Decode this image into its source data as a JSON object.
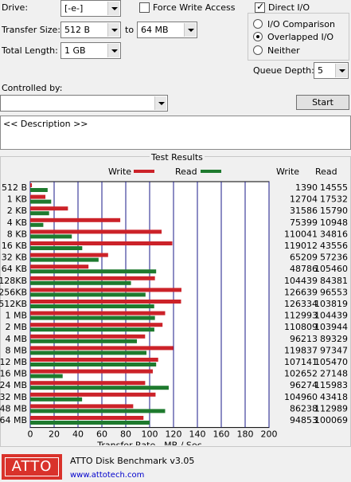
{
  "settings": {
    "drive_label": "Drive:",
    "drive_value": "[-e-]",
    "transfer_size_label": "Transfer Size:",
    "transfer_from": "512 B",
    "to_label": "to",
    "transfer_to": "64 MB",
    "total_length_label": "Total Length:",
    "total_length_value": "1 GB",
    "force_write_label": "Force Write Access",
    "direct_io_label": "Direct I/O",
    "io_comparison_label": "I/O Comparison",
    "overlapped_io_label": "Overlapped I/O",
    "neither_label": "Neither",
    "queue_depth_label": "Queue Depth:",
    "queue_depth_value": "5",
    "controlled_by_label": "Controlled by:",
    "controlled_by_value": "",
    "start_label": "Start",
    "description_text": "<< Description >>"
  },
  "results": {
    "title": "Test Results",
    "write_legend": "Write",
    "read_legend": "Read",
    "write_header": "Write",
    "read_header": "Read",
    "write_color": "#cc2229",
    "read_color": "#1e7a2e"
  },
  "chart_data": {
    "type": "bar",
    "orientation": "horizontal",
    "categories": [
      "512 B",
      "1 KB",
      "2 KB",
      "4 KB",
      "8 KB",
      "16 KB",
      "32 KB",
      "64 KB",
      "128KB",
      "256KB",
      "512KB",
      "1 MB",
      "2 MB",
      "4 MB",
      "8 MB",
      "12 MB",
      "16 MB",
      "24 MB",
      "32 MB",
      "48 MB",
      "64 MB"
    ],
    "series": [
      {
        "name": "Write",
        "values": [
          1390,
          12704,
          31586,
          75399,
          110041,
          119012,
          65209,
          48786,
          104439,
          126639,
          126334,
          112993,
          110809,
          96213,
          119837,
          107141,
          102652,
          96274,
          104960,
          86238,
          94853
        ]
      },
      {
        "name": "Read",
        "values": [
          14555,
          17532,
          15790,
          10948,
          34816,
          43556,
          57236,
          105460,
          84381,
          96553,
          103819,
          104439,
          103944,
          89329,
          97347,
          105470,
          27148,
          115983,
          43418,
          112989,
          100069
        ]
      }
    ],
    "xlabel": "Transfer Rate - MB / Sec",
    "xlim": [
      0,
      200
    ],
    "xticks": [
      "0",
      "20",
      "40",
      "60",
      "80",
      "100",
      "120",
      "140",
      "160",
      "180",
      "200"
    ],
    "grid": true
  },
  "footer": {
    "logo_text": "ATTO",
    "product_title": "ATTO Disk Benchmark v3.05",
    "url": "www.attotech.com",
    "logo_color": "#d9322b"
  }
}
